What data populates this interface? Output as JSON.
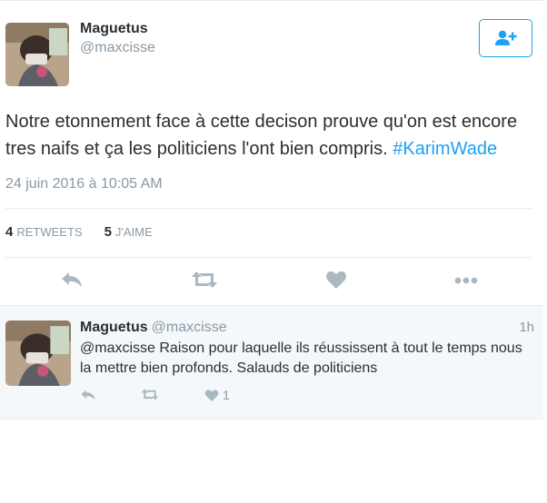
{
  "tweet": {
    "author_name": "Maguetus",
    "author_handle": "@maxcisse",
    "text_main": "Notre etonnement face à cette decison prouve qu'on est encore tres naifs et ça les politiciens l'ont bien compris. ",
    "hashtag": "#KarimWade",
    "timestamp": "24 juin 2016 à 10:05 AM",
    "retweets_count": "4",
    "retweets_label": "RETWEETS",
    "likes_count": "5",
    "likes_label": "J'AIME"
  },
  "reply": {
    "author_name": "Maguetus",
    "author_handle": "@maxcisse",
    "time": "1h",
    "text": "@maxcisse Raison pour laquelle ils réussissent à tout le temps nous la mettre bien profonds. Salauds de politiciens",
    "like_count": "1"
  },
  "icons": [
    "follow-user-icon",
    "reply-icon",
    "retweet-icon",
    "like-heart-icon",
    "more-dots-icon"
  ],
  "colors": {
    "accent": "#1da1f2",
    "muted": "#8899a6",
    "icon": "#aab8c2",
    "reply_bg": "#f5f8fa"
  }
}
